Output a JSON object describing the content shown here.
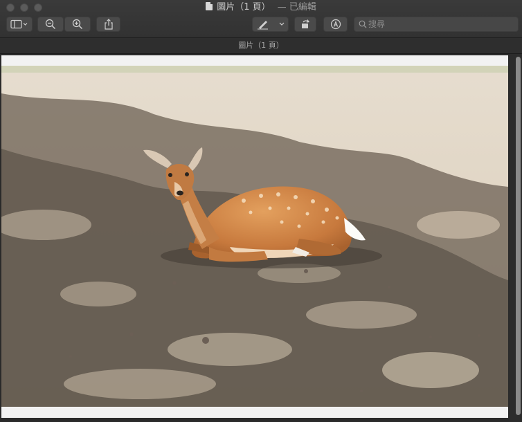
{
  "window": {
    "title": "圖片（1 頁）",
    "subtitle": "— 已編輯"
  },
  "toolbar": {
    "sidebar_icon": "sidebar-icon",
    "zoom_out_icon": "zoom-out-icon",
    "zoom_in_icon": "zoom-in-icon",
    "share_icon": "share-icon",
    "markup_pen_icon": "pen-icon",
    "rotate_icon": "rotate-icon",
    "annotate_icon": "markup-icon",
    "search_placeholder": "搜尋"
  },
  "page_header": "圖片（1 頁）",
  "colors": {
    "window_bg": "#2b2b2b",
    "toolbar_bg": "#363636",
    "button_bg": "#4a4a4a",
    "scroll_thumb": "#8b8b8b"
  }
}
